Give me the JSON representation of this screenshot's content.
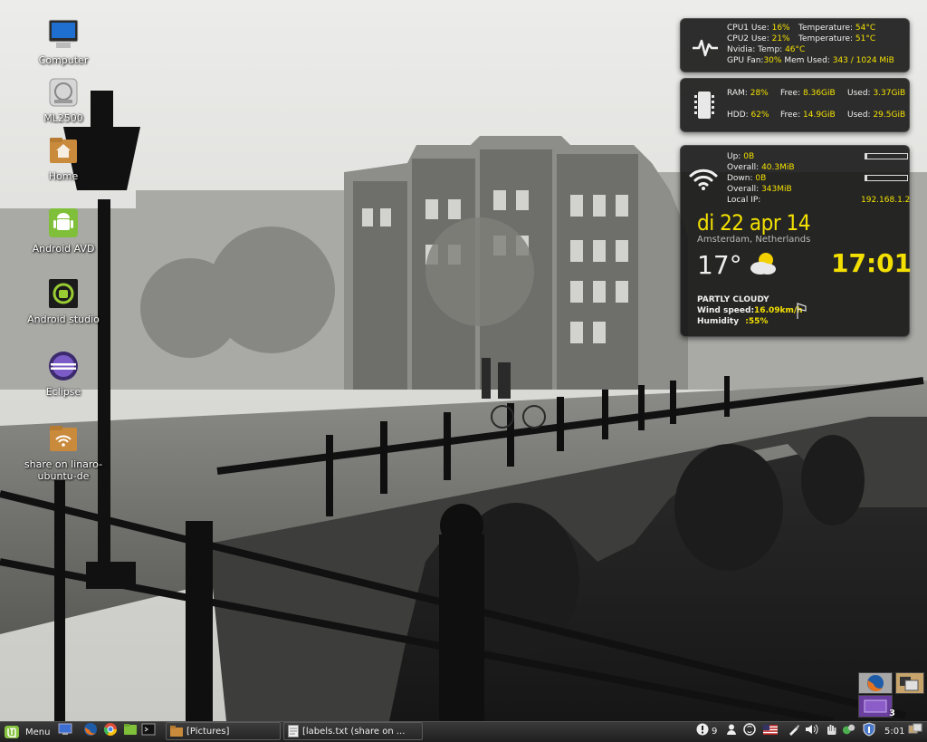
{
  "desktop": {
    "icons": [
      {
        "label": "Computer",
        "icon": "monitor-icon"
      },
      {
        "label": "ML2500",
        "icon": "printer-icon"
      },
      {
        "label": "Home",
        "icon": "home-folder-icon"
      },
      {
        "label": "Android AVD",
        "icon": "android-icon"
      },
      {
        "label": "Android studio",
        "icon": "android-studio-icon"
      },
      {
        "label": "Eclipse",
        "icon": "eclipse-icon"
      },
      {
        "label": "share on linaro-ubuntu-de",
        "icon": "network-share-icon"
      }
    ]
  },
  "conky": {
    "cpu": {
      "cpu1_label": "CPU1  Use:",
      "cpu1_use": "16%",
      "cpu1_temp_label": "Temperature:",
      "cpu1_temp": "54°C",
      "cpu2_label": "CPU2  Use:",
      "cpu2_use": "21%",
      "cpu2_temp_label": "Temperature:",
      "cpu2_temp": "51°C",
      "nvidia_label": "Nvidia:  Temp:",
      "nvidia_temp": "46°C",
      "gpu_fan_label": "GPU Fan:",
      "gpu_fan": "30%",
      "mem_used_label": "Mem Used:",
      "mem_used": "343 / 1024 MiB"
    },
    "memory": {
      "ram_label": "RAM:",
      "ram_pct": "28%",
      "ram_free_label": "Free:",
      "ram_free": "8.36GiB",
      "ram_used_label": "Used:",
      "ram_used": "3.37GiB",
      "hdd_label": "HDD:",
      "hdd_pct": "62%",
      "hdd_free_label": "Free:",
      "hdd_free": "14.9GiB",
      "hdd_used_label": "Used:",
      "hdd_used": "29.5GiB"
    },
    "network": {
      "up_label": "Up:",
      "up": "0B",
      "overall1_label": "Overall:",
      "overall1": "40.3MiB",
      "down_label": "Down:",
      "down": "0B",
      "overall2_label": "Overall:",
      "overall2": "343MiB",
      "local_ip_label": "Local IP:",
      "local_ip": "192.168.1.2",
      "up_bar_fraction": 0.05,
      "down_bar_fraction": 0.05
    },
    "weather": {
      "date": "di 22 apr 14",
      "location": "Amsterdam, Netherlands",
      "temperature": "17°",
      "time": "17:01",
      "condition": "PARTLY CLOUDY",
      "wind_label": "Wind speed:",
      "wind": "16.09km/h",
      "humidity_label": "Humidity",
      "humidity": ":55%"
    }
  },
  "workspace_badge": "3",
  "taskbar": {
    "menu_label": "Menu",
    "launchers": [
      "show-desktop-icon",
      "firefox-icon",
      "chrome-icon",
      "files-icon",
      "terminal-icon"
    ],
    "windows": [
      {
        "label": "[Pictures]",
        "icon": "folder-icon"
      },
      {
        "label": "[labels.txt (share on ...",
        "icon": "text-editor-icon"
      }
    ],
    "tray": {
      "update_count": "9",
      "clock": "5:01"
    }
  },
  "colors": {
    "conky_accent": "#f3e000",
    "conky_bg": "#121212",
    "taskbar_bg": "#2a2a2a"
  }
}
